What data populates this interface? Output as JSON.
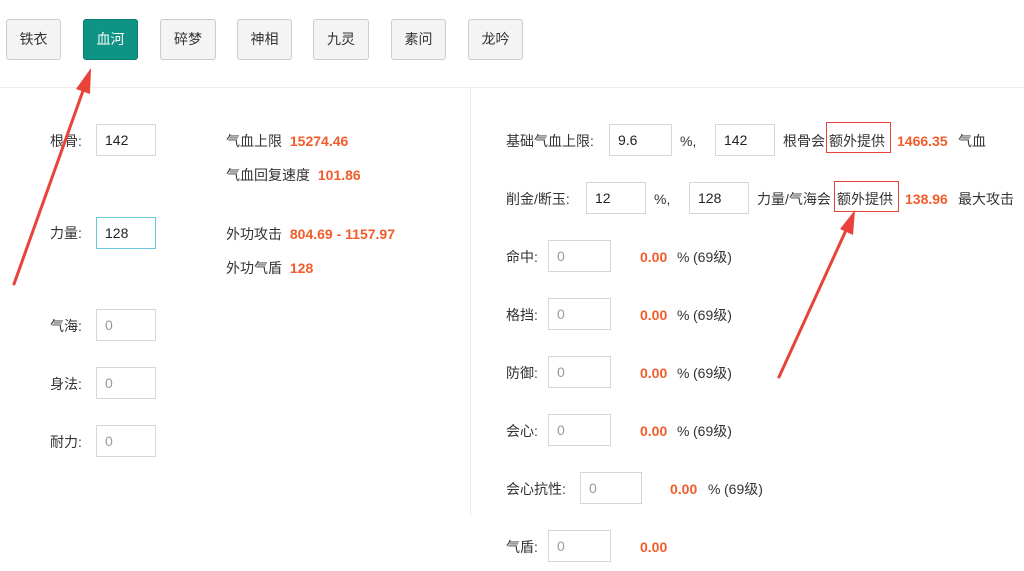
{
  "tabs": [
    "铁衣",
    "血河",
    "碎梦",
    "神相",
    "九灵",
    "素问",
    "龙吟"
  ],
  "active_tab": "血河",
  "left": {
    "gengu_label": "根骨:",
    "gengu_value": "142",
    "liliang_label": "力量:",
    "liliang_value": "128",
    "qihai_label": "气海:",
    "qihai_placeholder": "0",
    "shenfa_label": "身法:",
    "shenfa_placeholder": "0",
    "naili_label": "耐力:",
    "naili_placeholder": "0",
    "qixue_shangxian_label": "气血上限",
    "qixue_shangxian_value": "15274.46",
    "qixue_huifu_label": "气血回复速度",
    "qixue_huifu_value": "101.86",
    "waigong_gongji_label": "外功攻击",
    "waigong_gongji_value": "804.69 - 1157.97",
    "waigong_qidun_label": "外功气盾",
    "waigong_qidun_value": "128"
  },
  "right": {
    "row1": {
      "label": "基础气血上限:",
      "input1": "9.6",
      "unit1": "%,",
      "input2": "142",
      "text_before": "根骨会",
      "text_boxed": "额外提供",
      "value": "1466.35",
      "text_after": "气血"
    },
    "row2": {
      "label": "削金/断玉:",
      "input1": "12",
      "unit1": "%,",
      "input2": "128",
      "text_before": "力量/气海会",
      "text_boxed": "额外提供",
      "value": "138.96",
      "text_after": "最大攻击"
    },
    "stats": [
      {
        "label": "命中:",
        "placeholder": "0",
        "value": "0.00",
        "unit": "%",
        "level": "(69级)"
      },
      {
        "label": "格挡:",
        "placeholder": "0",
        "value": "0.00",
        "unit": "%",
        "level": "(69级)"
      },
      {
        "label": "防御:",
        "placeholder": "0",
        "value": "0.00",
        "unit": "%",
        "level": "(69级)"
      },
      {
        "label": "会心:",
        "placeholder": "0",
        "value": "0.00",
        "unit": "%",
        "level": "(69级)"
      },
      {
        "label": "会心抗性:",
        "placeholder": "0",
        "value": "0.00",
        "unit": "%",
        "level": "(69级)"
      },
      {
        "label": "气盾:",
        "placeholder": "0",
        "value": "0.00"
      }
    ]
  },
  "colors": {
    "active_tab": "#0e9384",
    "value_orange": "#f25c2b",
    "annotation_red": "#e8423a",
    "focus_border": "#68c7d8"
  }
}
